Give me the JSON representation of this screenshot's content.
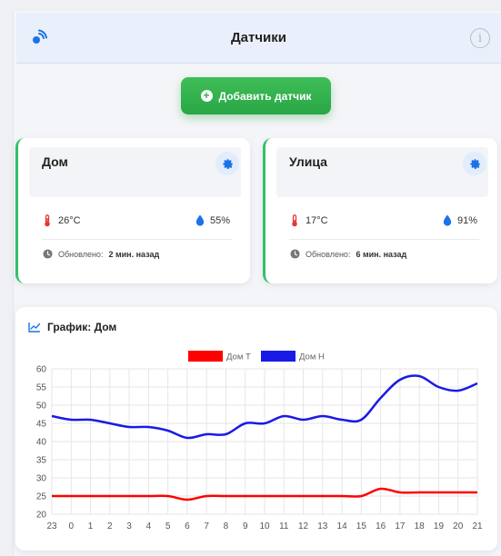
{
  "header": {
    "title": "Датчики",
    "info_glyph": "i"
  },
  "toolbar": {
    "add_label": "Добавить датчик"
  },
  "sensors": [
    {
      "name": "Дом",
      "temp": "26°C",
      "humidity": "55%",
      "updated_label": "Обновлено:",
      "updated_value": "2 мин. назад"
    },
    {
      "name": "Улица",
      "temp": "17°C",
      "humidity": "91%",
      "updated_label": "Обновлено:",
      "updated_value": "6 мин. назад"
    }
  ],
  "colors": {
    "accent": "#1a73e8",
    "green": "#28a745",
    "temp": "#e53935",
    "humidity": "#1565c0"
  },
  "chart_title": "График: Дом",
  "chart_data": {
    "type": "line",
    "categories": [
      "23",
      "0",
      "1",
      "2",
      "3",
      "4",
      "5",
      "6",
      "7",
      "8",
      "9",
      "10",
      "11",
      "12",
      "13",
      "14",
      "15",
      "16",
      "17",
      "18",
      "19",
      "20",
      "21"
    ],
    "series": [
      {
        "name": "Дом T",
        "color": "#ff0000",
        "values": [
          25,
          25,
          25,
          25,
          25,
          25,
          25,
          24,
          25,
          25,
          25,
          25,
          25,
          25,
          25,
          25,
          25,
          27,
          26,
          26,
          26,
          26,
          26
        ]
      },
      {
        "name": "Дом H",
        "color": "#1a1ae6",
        "values": [
          47,
          46,
          46,
          45,
          44,
          44,
          43,
          41,
          42,
          42,
          45,
          45,
          47,
          46,
          47,
          46,
          46,
          52,
          57,
          58,
          55,
          54,
          56
        ]
      }
    ],
    "ylim": [
      20,
      60
    ],
    "yticks": [
      20,
      25,
      30,
      35,
      40,
      45,
      50,
      55,
      60
    ],
    "grid": true,
    "legend": "top-center"
  }
}
